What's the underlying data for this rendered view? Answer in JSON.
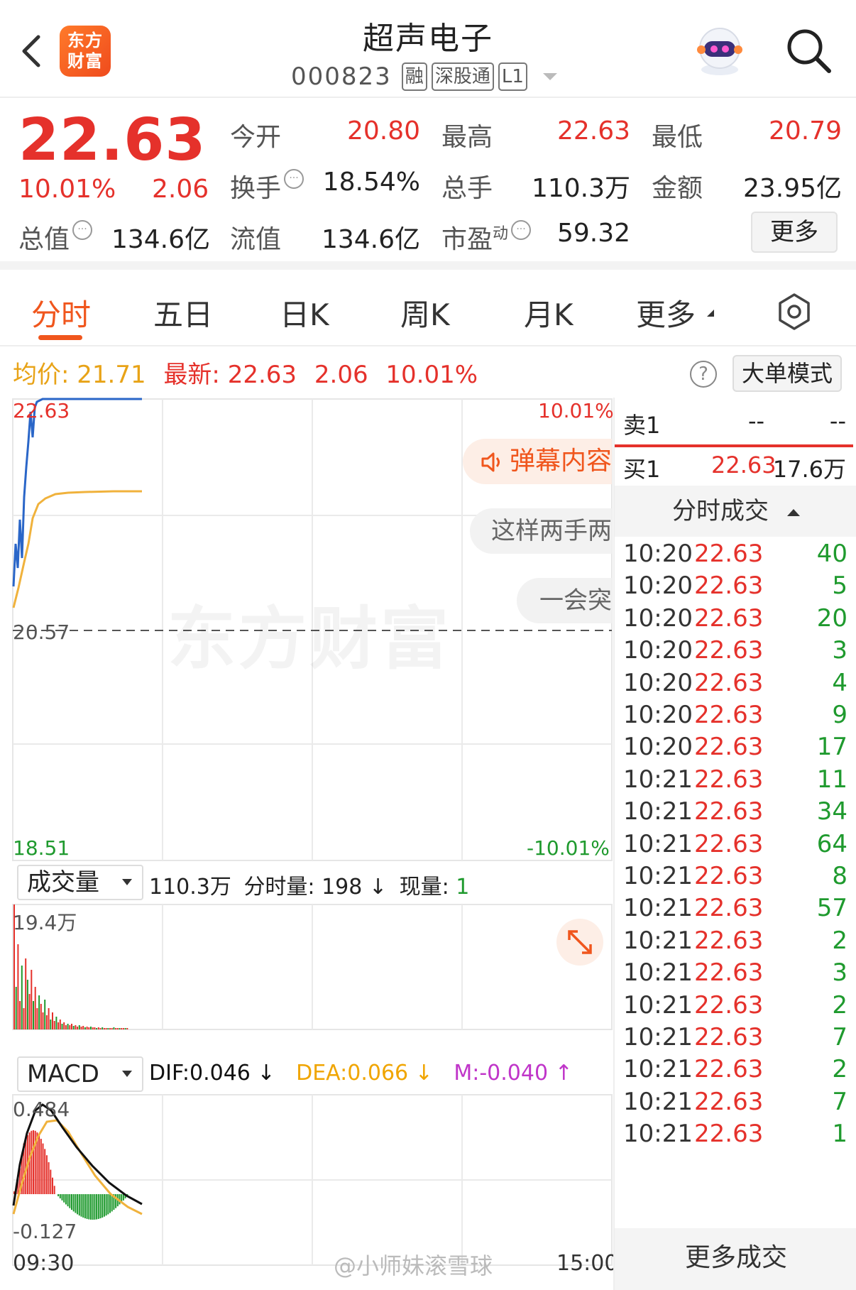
{
  "header": {
    "back_icon": "chevron-left-icon",
    "logo_text_line1": "东方",
    "logo_text_line2": "财富",
    "stock_name": "超声电子",
    "stock_code": "000823",
    "tags": [
      "融",
      "深股通",
      "L1"
    ],
    "avatar_icon": "robot-assistant-icon",
    "search_icon": "search-icon"
  },
  "quote": {
    "price": "22.63",
    "change_pct": "10.01%",
    "change": "2.06",
    "fields": {
      "open_label": "今开",
      "open": "20.80",
      "high_label": "最高",
      "high": "22.63",
      "low_label": "最低",
      "low": "20.79",
      "turnover_label": "换手",
      "turnover": "18.54%",
      "volume_label": "总手",
      "volume": "110.3万",
      "amount_label": "金额",
      "amount": "23.95亿",
      "mktcap_label": "总值",
      "mktcap": "134.6亿",
      "float_label": "流值",
      "float": "134.6亿",
      "pe_label": "市盈",
      "pe_sup": "动",
      "pe": "59.32"
    },
    "more_label": "更多",
    "colors": {
      "up": "#e5312b",
      "down": "#1f9a2e",
      "accent": "#f0561d"
    }
  },
  "tabs": [
    "分时",
    "五日",
    "日K",
    "周K",
    "月K",
    "更多"
  ],
  "active_tab": "分时",
  "info_line": {
    "avg_label": "均价:",
    "avg": "21.71",
    "latest_label": "最新:",
    "latest": "22.63",
    "latest_chg": "2.06",
    "latest_pct": "10.01%"
  },
  "big_order_label": "大单模式",
  "chart": {
    "y_top": "22.63",
    "y_mid": "20.57",
    "y_bottom": "18.51",
    "pct_top": "10.01%",
    "pct_bottom": "-10.01%",
    "watermark": "东方财富",
    "danmu": [
      "弹幕内容",
      "这样两手两",
      "一会突"
    ],
    "danmu_icon": "speaker-icon"
  },
  "volume_panel": {
    "select": "成交量",
    "info_total": "110.3万",
    "info_min_label": "分时量:",
    "info_min": "198 ↓",
    "info_cur_label": "现量:",
    "info_cur": "1",
    "max_label": "19.4万"
  },
  "macd_panel": {
    "select": "MACD",
    "dif": "DIF:0.046 ↓",
    "dea": "DEA:0.066 ↓",
    "m": "M:-0.040 ↑",
    "max_label": "0.484",
    "min_label": "-0.127",
    "colors": {
      "dif": "#111111",
      "dea": "#f0a500",
      "m": "#c035c9"
    }
  },
  "time_axis": {
    "start": "09:30",
    "end": "15:00"
  },
  "order_book": {
    "sell1_label": "卖1",
    "sell1_price": "--",
    "sell1_vol": "--",
    "buy1_label": "买1",
    "buy1_price": "22.63",
    "buy1_vol": "17.6万"
  },
  "trades_header": "分时成交",
  "trades": [
    {
      "t": "10:20",
      "p": "22.63",
      "v": "40"
    },
    {
      "t": "10:20",
      "p": "22.63",
      "v": "5"
    },
    {
      "t": "10:20",
      "p": "22.63",
      "v": "20"
    },
    {
      "t": "10:20",
      "p": "22.63",
      "v": "3"
    },
    {
      "t": "10:20",
      "p": "22.63",
      "v": "4"
    },
    {
      "t": "10:20",
      "p": "22.63",
      "v": "9"
    },
    {
      "t": "10:20",
      "p": "22.63",
      "v": "17"
    },
    {
      "t": "10:21",
      "p": "22.63",
      "v": "11"
    },
    {
      "t": "10:21",
      "p": "22.63",
      "v": "34"
    },
    {
      "t": "10:21",
      "p": "22.63",
      "v": "64"
    },
    {
      "t": "10:21",
      "p": "22.63",
      "v": "8"
    },
    {
      "t": "10:21",
      "p": "22.63",
      "v": "57"
    },
    {
      "t": "10:21",
      "p": "22.63",
      "v": "2"
    },
    {
      "t": "10:21",
      "p": "22.63",
      "v": "3"
    },
    {
      "t": "10:21",
      "p": "22.63",
      "v": "2"
    },
    {
      "t": "10:21",
      "p": "22.63",
      "v": "7"
    },
    {
      "t": "10:21",
      "p": "22.63",
      "v": "2"
    },
    {
      "t": "10:21",
      "p": "22.63",
      "v": "7"
    },
    {
      "t": "10:21",
      "p": "22.63",
      "v": "1"
    }
  ],
  "more_trades": "更多成交",
  "weibo_watermark": "@小师妹滚雪球"
}
